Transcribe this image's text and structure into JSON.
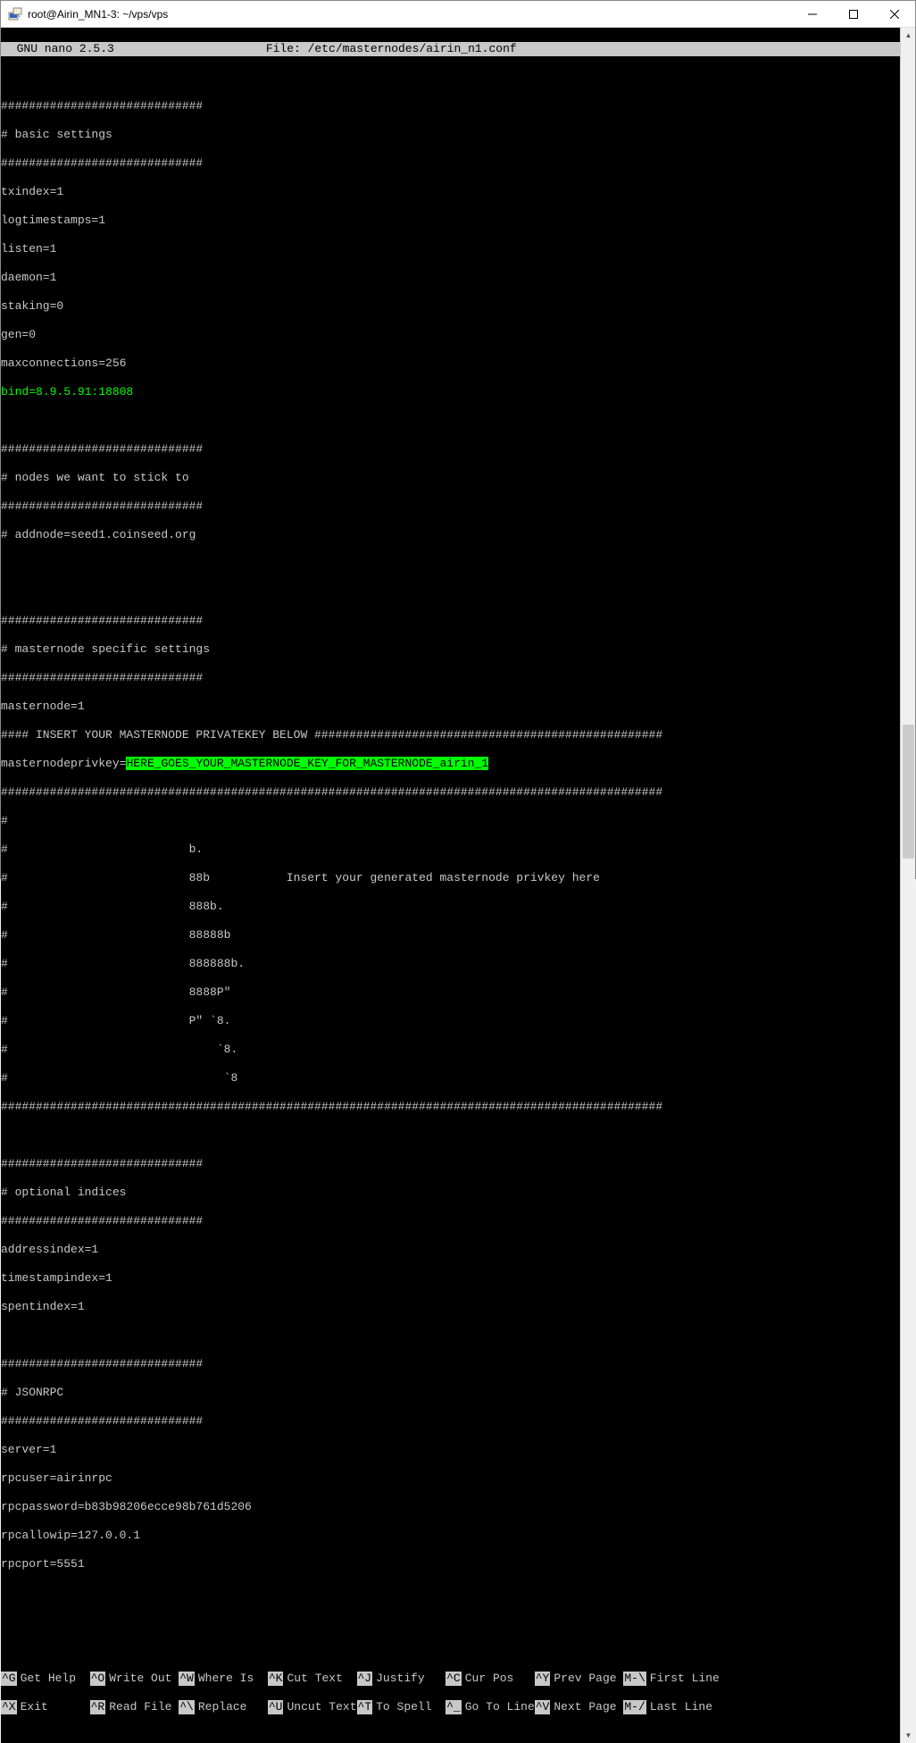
{
  "window": {
    "title": "root@Airin_MN1-3: ~/vps/vps"
  },
  "nano": {
    "app": "  GNU nano 2.5.3",
    "file_label": "File: /etc/masternodes/airin_n1.conf"
  },
  "content": {
    "sep1": "#############################",
    "l01": "# basic settings",
    "sep2": "#############################",
    "l02": "txindex=1",
    "l03": "logtimestamps=1",
    "l04": "listen=1",
    "l05": "daemon=1",
    "l06": "staking=0",
    "l07": "gen=0",
    "l08": "maxconnections=256",
    "l09": "bind=8.9.5.91:18808",
    "sep3": "#############################",
    "l10": "# nodes we want to stick to",
    "sep4": "#############################",
    "l11": "# addnode=seed1.coinseed.org",
    "sep5": "#############################",
    "l12": "# masternode specific settings",
    "sep6": "#############################",
    "l13": "masternode=1",
    "l14": "#### INSERT YOUR MASTERNODE PRIVATEKEY BELOW ##################################################",
    "l15a": "masternodeprivkey=",
    "l15b": "HERE_GOES_YOUR_MASTERNODE_KEY_FOR_MASTERNODE_airin_1",
    "sep7": "###############################################################################################",
    "a0": "#",
    "a1": "#                          b.",
    "a2": "#                          88b           Insert your generated masternode privkey here",
    "a3": "#                          888b.",
    "a4": "#                          88888b",
    "a5": "#                          888888b.",
    "a6": "#                          8888P\"",
    "a7": "#                          P\" `8.",
    "a8": "#                              `8.",
    "a9": "#                               `8",
    "sep8": "###############################################################################################",
    "sep9": "#############################",
    "l20": "# optional indices",
    "sep10": "#############################",
    "l21": "addressindex=1",
    "l22": "timestampindex=1",
    "l23": "spentindex=1",
    "sep11": "#############################",
    "l24": "# JSONRPC",
    "sep12": "#############################",
    "l25": "server=1",
    "l26": "rpcuser=airinrpc",
    "l27": "rpcpassword=b83b98206ecce98b761d5206",
    "l28": "rpcallowip=127.0.0.1",
    "l29": "rpcport=5551"
  },
  "shortcuts": {
    "r1k1": "^G",
    "r1l1": "Get Help  ",
    "r1k2": "^O",
    "r1l2": "Write Out ",
    "r1k3": "^W",
    "r1l3": "Where Is  ",
    "r1k4": "^K",
    "r1l4": "Cut Text  ",
    "r1k5": "^J",
    "r1l5": "Justify   ",
    "r1k6": "^C",
    "r1l6": "Cur Pos   ",
    "r1k7": "^Y",
    "r1l7": "Prev Page ",
    "r1k8": "M-\\",
    "r1l8": "First Line",
    "r2k1": "^X",
    "r2l1": "Exit      ",
    "r2k2": "^R",
    "r2l2": "Read File ",
    "r2k3": "^\\",
    "r2l3": "Replace   ",
    "r2k4": "^U",
    "r2l4": "Uncut Text",
    "r2k5": "^T",
    "r2l5": "To Spell  ",
    "r2k6": "^_",
    "r2l6": "Go To Line",
    "r2k7": "^V",
    "r2l7": "Next Page ",
    "r2k8": "M-/",
    "r2l8": "Last Line"
  }
}
